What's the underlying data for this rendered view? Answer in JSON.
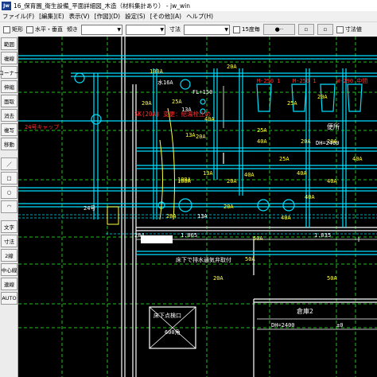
{
  "window": {
    "title": "16_保育園_衛生設備_平面詳細図_木造（材料集計あり） - jw_win",
    "app_icon": "Jw"
  },
  "menu": [
    "ファイル(F)",
    "[編集](E)",
    "表示(V)",
    "[作図](D)",
    "設定(S)",
    "[その他](A)",
    "ヘルプ(H)"
  ],
  "toolbar": {
    "rect_label": "矩形",
    "hv_label": "水平・垂直",
    "slope_label": "傾き",
    "dim_label": "寸法",
    "snap15_label": "15度毎",
    "dim_value_label": "寸法値"
  },
  "sidebar": {
    "group1": [
      "範囲",
      "複線",
      "コーナー",
      "伸縮",
      "面取",
      "消去",
      "複写",
      "移動"
    ],
    "group2": [
      "文字",
      "寸法",
      "2線",
      "中心線",
      "連線",
      "AUTO"
    ]
  },
  "colors": {
    "canvas_bg": "#000000",
    "pipe": "#00e0ff",
    "grid": "#20c020",
    "text": "#ffff40",
    "annotation": "#ff3030",
    "wall": "#ffffff"
  },
  "drawing": {
    "labels_yellow": [
      "20A",
      "100A",
      "水16A",
      "25A",
      "20A",
      "25A",
      "20A",
      "25A",
      "40A",
      "20A",
      "13A",
      "40A",
      "20A",
      "20A",
      "25A",
      "40A",
      "13A",
      "40A",
      "100A",
      "40A",
      "40A",
      "20A",
      "20A",
      "40A",
      "20A",
      "40A",
      "1.865",
      "1.035",
      "284",
      "50A",
      "50A",
      "20A",
      "50A",
      "24号",
      "100A"
    ],
    "labels_white": [
      "FL+150",
      "便所",
      "DH=2400",
      "床下で排水通気弁取付",
      "倉庫2",
      "DH=2400",
      "±0",
      "床下点検口",
      "600角",
      "13A",
      "13A"
    ],
    "labels_red": [
      "SK(20A) 変更：給湯栓止め",
      "M-250 1",
      "M-250 1",
      "W-290 中間",
      "24号キャップ"
    ]
  }
}
